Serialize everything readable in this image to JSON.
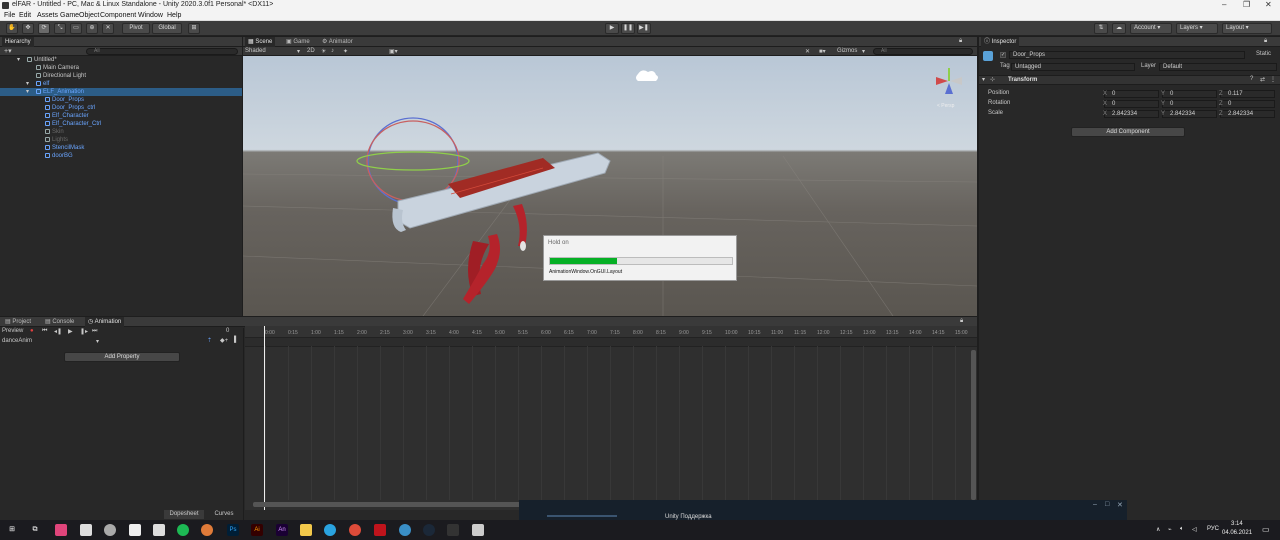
{
  "window": {
    "title": "elFAR - Untitled - PC, Mac & Linux Standalone - Unity 2020.3.0f1 Personal* <DX11>"
  },
  "menu": [
    "File",
    "Edit",
    "Assets",
    "GameObject",
    "Component",
    "Window",
    "Help"
  ],
  "toolbar": {
    "pivot": "Pivot",
    "global": "Global",
    "account": "Account",
    "layers": "Layers",
    "layout": "Layout"
  },
  "hierarchy": {
    "tab": "Hierarchy",
    "search_placeholder": "All",
    "items": [
      {
        "label": "Untitled*",
        "depth": 0,
        "style": "normal"
      },
      {
        "label": "Main Camera",
        "depth": 1,
        "style": "normal"
      },
      {
        "label": "Directional Light",
        "depth": 1,
        "style": "normal"
      },
      {
        "label": "elf",
        "depth": 1,
        "style": "blue"
      },
      {
        "label": "ELF_Animation",
        "depth": 1,
        "style": "selected"
      },
      {
        "label": "Door_Props",
        "depth": 2,
        "style": "blue"
      },
      {
        "label": "Door_Props_ctrl",
        "depth": 2,
        "style": "blue"
      },
      {
        "label": "Elf_Character",
        "depth": 2,
        "style": "blue"
      },
      {
        "label": "Elf_Character_Ctrl",
        "depth": 2,
        "style": "blue"
      },
      {
        "label": "Skin",
        "depth": 2,
        "style": "dim"
      },
      {
        "label": "Lights",
        "depth": 2,
        "style": "dim"
      },
      {
        "label": "StencilMask",
        "depth": 2,
        "style": "blue"
      },
      {
        "label": "doorBG",
        "depth": 2,
        "style": "blue"
      }
    ]
  },
  "scene": {
    "tabs": [
      "Scene",
      "Game",
      "Animator"
    ],
    "shading": "Shaded",
    "mode_2d": "2D",
    "gizmos": "Gizmos",
    "search_placeholder": "All",
    "persp_label": "< Persp"
  },
  "dialog": {
    "title": "Hold on",
    "message": "AnimationWindow.OnGUI.Layout",
    "progress": 0.37,
    "fill_color": "#06b025"
  },
  "inspector": {
    "tab": "Inspector",
    "object_name": "Door_Props",
    "static": "Static",
    "tag_label": "Tag",
    "tag_value": "Untagged",
    "layer_label": "Layer",
    "layer_value": "Default",
    "component": "Transform",
    "rows": [
      {
        "label": "Position",
        "x": "0",
        "y": "0",
        "z": "0.117"
      },
      {
        "label": "Rotation",
        "x": "0",
        "y": "0",
        "z": "0"
      },
      {
        "label": "Scale",
        "x": "2.842334",
        "y": "2.842334",
        "z": "2.842334"
      }
    ],
    "add_component": "Add Component"
  },
  "bottom": {
    "tabs": [
      "Project",
      "Console",
      "Animation"
    ],
    "preview": "Preview",
    "frame": "0",
    "clip": "danceAnim",
    "add_property": "Add Property",
    "dopesheet": "Dopesheet",
    "curves": "Curves",
    "ticks": [
      "0:00",
      "0:15",
      "1:00",
      "1:15",
      "2:00",
      "2:15",
      "3:00",
      "3:15",
      "4:00",
      "4:15",
      "5:00",
      "5:15",
      "6:00",
      "6:15",
      "7:00",
      "7:15",
      "8:00",
      "8:15",
      "9:00",
      "9:15",
      "10:00",
      "10:15",
      "11:00",
      "11:15",
      "12:00",
      "12:15",
      "13:00",
      "13:15",
      "14:00",
      "14:15",
      "15:00"
    ]
  },
  "taskbar": {
    "popup": "Unity Поддержка",
    "lang": "РУС",
    "time": "3:14",
    "date": "04.06.2021"
  }
}
